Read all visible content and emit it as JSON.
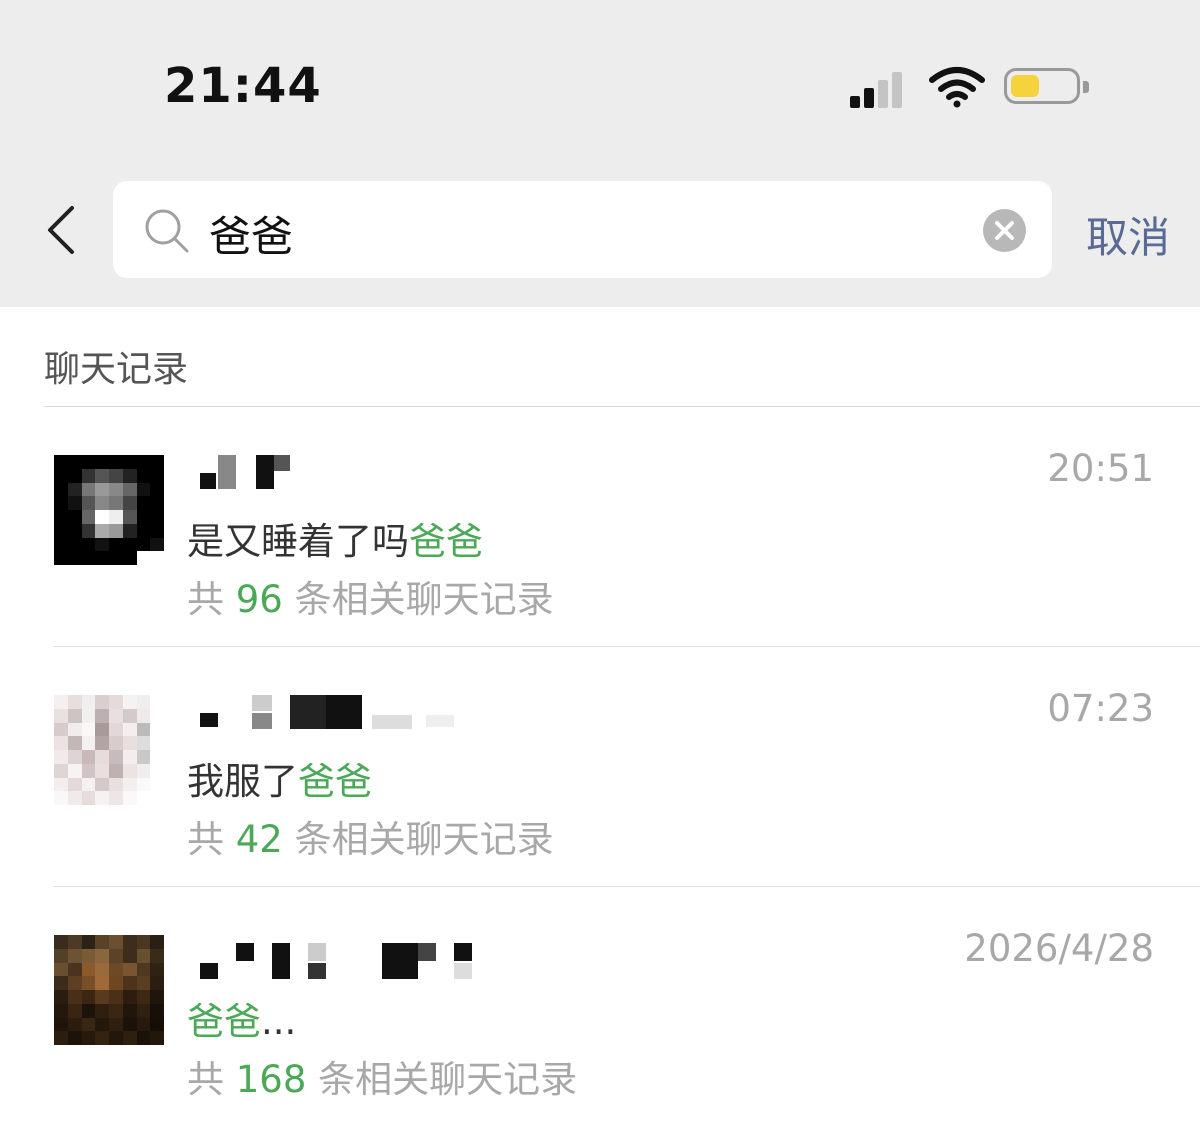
{
  "status_bar": {
    "time": "21:44",
    "icons": [
      "cellular-signal-icon",
      "wifi-icon",
      "battery-icon"
    ],
    "battery_color": "#f5d33d"
  },
  "search": {
    "query": "爸爸",
    "cancel_label": "取消"
  },
  "section": {
    "title": "聊天记录"
  },
  "results": [
    {
      "name": "",
      "time": "20:51",
      "message_before": "是又睡着了吗",
      "message_highlight": "爸爸",
      "message_after": "",
      "count_prefix": "共",
      "count": "96",
      "count_suffix": "条相关聊天记录"
    },
    {
      "name": "",
      "time": "07:23",
      "message_before": "我服了",
      "message_highlight": "爸爸",
      "message_after": "",
      "count_prefix": "共",
      "count": "42",
      "count_suffix": "条相关聊天记录"
    },
    {
      "name": "",
      "time": "2026/4/28",
      "message_before": "",
      "message_highlight": "爸爸",
      "message_after": "...",
      "count_prefix": "共",
      "count": "168",
      "count_suffix": "条相关聊天记录"
    }
  ],
  "colors": {
    "highlight": "#4aa856",
    "link": "#576b95",
    "muted": "#a8a8a8",
    "header_bg": "#ededed"
  }
}
